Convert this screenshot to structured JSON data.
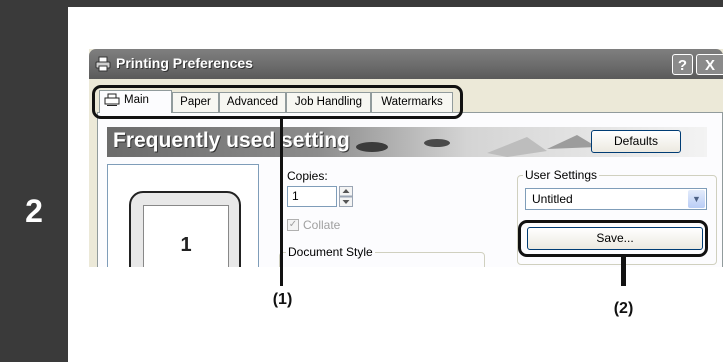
{
  "step": {
    "number": "2"
  },
  "window": {
    "title": "Printing Preferences",
    "help_label": "?",
    "close_label": "X",
    "tabs": [
      {
        "label": "Main"
      },
      {
        "label": "Paper"
      },
      {
        "label": "Advanced"
      },
      {
        "label": "Job Handling"
      },
      {
        "label": "Watermarks"
      }
    ],
    "active_tab": "Main",
    "banner": "Frequently used setting",
    "defaults_label": "Defaults",
    "preview_page_number": "1",
    "copies": {
      "label": "Copies:",
      "value": "1"
    },
    "collate": {
      "label": "Collate",
      "checked": true,
      "enabled": false
    },
    "document_style_label": "Document Style",
    "user_settings": {
      "label": "User Settings",
      "selected": "Untitled",
      "save_label": "Save..."
    }
  },
  "callouts": {
    "tabs": "(1)",
    "save": "(2)"
  },
  "colors": {
    "step_bar": "#3a3a3a",
    "titlebar": "#6a6a6a",
    "dialog_bg": "#ece9d8",
    "panel_bg": "#fcfcfe"
  }
}
